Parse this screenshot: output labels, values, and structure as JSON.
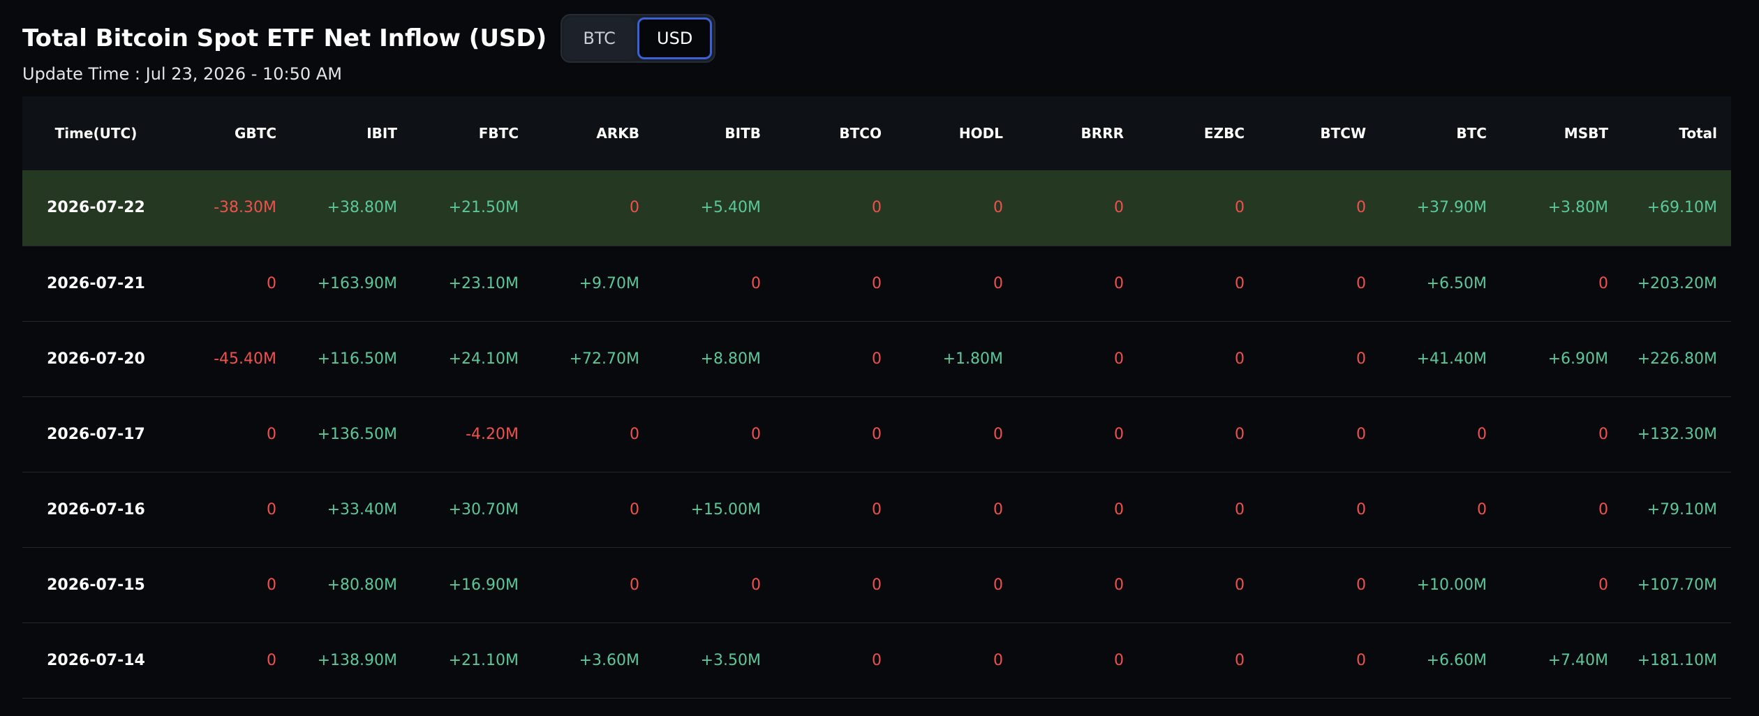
{
  "header": {
    "title": "Total Bitcoin Spot ETF Net Inflow (USD)",
    "update_time": "Update Time : Jul 23, 2026 - 10:50 AM"
  },
  "toggle": {
    "options": [
      "BTC",
      "USD"
    ],
    "selected": "USD"
  },
  "colors": {
    "positive": "#5cc79a",
    "negative": "#f0514e",
    "highlight_row": "#243822",
    "accent": "#3a62d6"
  },
  "table": {
    "columns": [
      "Time(UTC)",
      "GBTC",
      "IBIT",
      "FBTC",
      "ARKB",
      "BITB",
      "BTCO",
      "HODL",
      "BRRR",
      "EZBC",
      "BTCW",
      "BTC",
      "MSBT",
      "Total"
    ],
    "rows": [
      {
        "highlight": true,
        "cells": [
          "2026-07-22",
          "-38.30M",
          "+38.80M",
          "+21.50M",
          "0",
          "+5.40M",
          "0",
          "0",
          "0",
          "0",
          "0",
          "+37.90M",
          "+3.80M",
          "+69.10M"
        ]
      },
      {
        "highlight": false,
        "cells": [
          "2026-07-21",
          "0",
          "+163.90M",
          "+23.10M",
          "+9.70M",
          "0",
          "0",
          "0",
          "0",
          "0",
          "0",
          "+6.50M",
          "0",
          "+203.20M"
        ]
      },
      {
        "highlight": false,
        "cells": [
          "2026-07-20",
          "-45.40M",
          "+116.50M",
          "+24.10M",
          "+72.70M",
          "+8.80M",
          "0",
          "+1.80M",
          "0",
          "0",
          "0",
          "+41.40M",
          "+6.90M",
          "+226.80M"
        ]
      },
      {
        "highlight": false,
        "cells": [
          "2026-07-17",
          "0",
          "+136.50M",
          "-4.20M",
          "0",
          "0",
          "0",
          "0",
          "0",
          "0",
          "0",
          "0",
          "0",
          "+132.30M"
        ]
      },
      {
        "highlight": false,
        "cells": [
          "2026-07-16",
          "0",
          "+33.40M",
          "+30.70M",
          "0",
          "+15.00M",
          "0",
          "0",
          "0",
          "0",
          "0",
          "0",
          "0",
          "+79.10M"
        ]
      },
      {
        "highlight": false,
        "cells": [
          "2026-07-15",
          "0",
          "+80.80M",
          "+16.90M",
          "0",
          "0",
          "0",
          "0",
          "0",
          "0",
          "0",
          "+10.00M",
          "0",
          "+107.70M"
        ]
      },
      {
        "highlight": false,
        "cells": [
          "2026-07-14",
          "0",
          "+138.90M",
          "+21.10M",
          "+3.60M",
          "+3.50M",
          "0",
          "0",
          "0",
          "0",
          "0",
          "+6.60M",
          "+7.40M",
          "+181.10M"
        ]
      }
    ]
  }
}
